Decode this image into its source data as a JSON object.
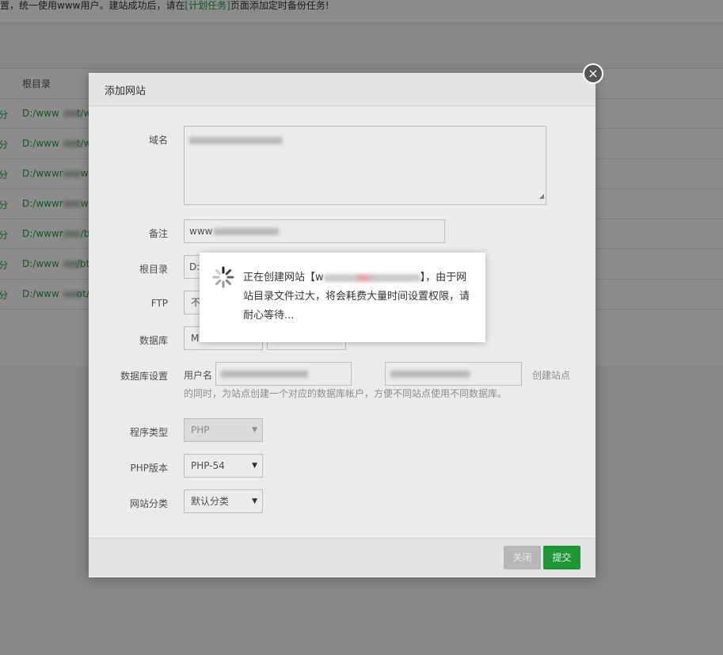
{
  "notice": {
    "prefix": "置，统一使用www用户。建站成功后，请在",
    "link": "[计划任务]",
    "suffix": "页面添加定时备份任务!"
  },
  "table": {
    "header": "根目录",
    "rows": [
      {
        "status": "分",
        "path": "D:/www",
        "tail": "t/w"
      },
      {
        "status": "分",
        "path": "D:/www",
        "tail": "t/w"
      },
      {
        "status": "分",
        "path": "D:/wwwr",
        "tail": "w"
      },
      {
        "status": "分",
        "path": "D:/wwwr",
        "tail": "w"
      },
      {
        "status": "分",
        "path": "D:/wwwr",
        "tail": "/bt"
      },
      {
        "status": "分",
        "path": "D:/www",
        "tail": "/bt"
      },
      {
        "status": "分",
        "path": "D:/www",
        "tail": "ot/w"
      }
    ]
  },
  "modal": {
    "title": "添加网站",
    "close_icon": "×",
    "form": {
      "domain_label": "域名",
      "remark_label": "备注",
      "remark_value": "www",
      "root_label": "根目录",
      "root_value": "D:",
      "ftp_label": "FTP",
      "ftp_value": "不",
      "database_label": "数据库",
      "database_value": "M",
      "db_settings_label": "数据库设置",
      "db_user_label": "用户名",
      "db_settings_hint_right": "创建站点",
      "db_settings_hint": "的同时，为站点创建一个对应的数据库帐户，方便不同站点使用不同数据库。",
      "program_type_label": "程序类型",
      "program_type_value": "PHP",
      "php_version_label": "PHP版本",
      "php_version_value": "PHP-54",
      "category_label": "网站分类",
      "category_value": "默认分类"
    },
    "buttons": {
      "close": "关闭",
      "submit": "提交"
    }
  },
  "loading": {
    "text_prefix": "正在创建网站【w",
    "text_suffix": "】，由于网站目录文件过大，将会耗费大量时间设置权限，请耐心等待..."
  },
  "colors": {
    "accent": "#20a53a",
    "overlay": "rgba(0,0,0,0.45)"
  }
}
